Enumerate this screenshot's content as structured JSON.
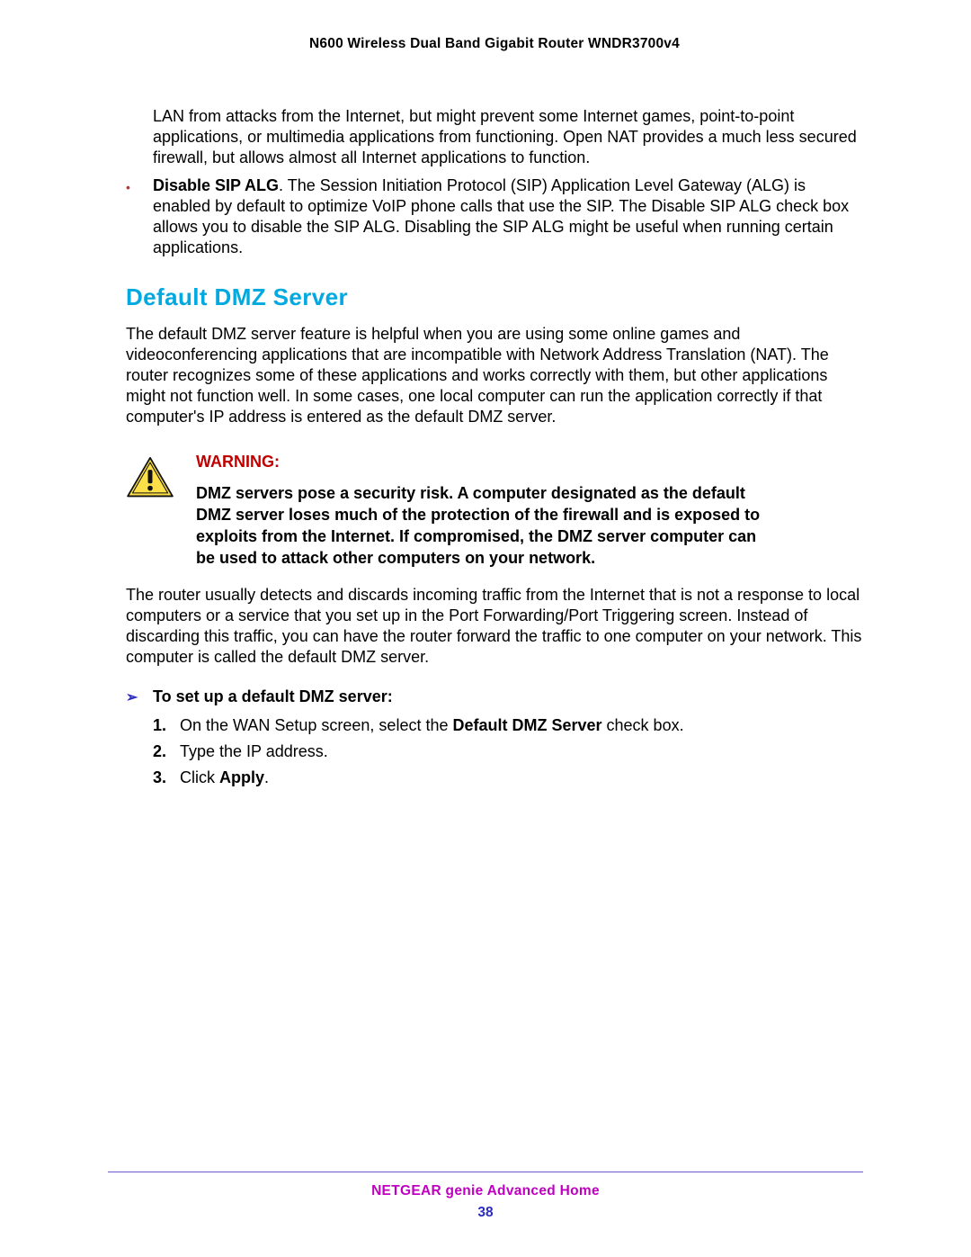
{
  "header": {
    "title": "N600 Wireless Dual Band Gigabit Router WNDR3700v4"
  },
  "continued": {
    "first_paragraph": "LAN from attacks from the Internet, but might prevent some Internet games, point-to-point applications, or multimedia applications from functioning. Open NAT provides a much less secured firewall, but allows almost all Internet applications to function.",
    "sip_label": "Disable SIP ALG",
    "sip_text": ". The Session Initiation Protocol (SIP) Application Level Gateway (ALG) is enabled by default to optimize VoIP phone calls that use the SIP. The Disable SIP ALG check box allows you to disable the SIP ALG. Disabling the SIP ALG might be useful when running certain applications."
  },
  "section": {
    "heading": "Default DMZ Server",
    "p1": "The default DMZ server feature is helpful when you are using some online games and videoconferencing applications that are incompatible with Network Address Translation (NAT). The router recognizes some of these applications and works correctly with them, but other applications might not function well. In some cases, one local computer can run the application correctly if that computer's IP address is entered as the default DMZ server.",
    "p2": "The router usually detects and discards incoming traffic from the Internet that is not a response to local computers or a service that you set up in the Port Forwarding/Port Triggering screen. Instead of discarding this traffic, you can have the router forward the traffic to one computer on your network. This computer is called the default DMZ server."
  },
  "warning": {
    "label": "WARNING:",
    "body": "DMZ servers pose a security risk. A computer designated as the default DMZ server loses much of the protection of the firewall and is exposed to exploits from the Internet. If compromised, the DMZ server computer can be used to attack other computers on your network."
  },
  "procedure": {
    "heading": "To set up a default DMZ server:",
    "steps": [
      {
        "n": "1.",
        "pre": "On the WAN Setup screen, select the ",
        "bold": "Default DMZ Server",
        "post": " check box."
      },
      {
        "n": "2.",
        "pre": "Type the IP address.",
        "bold": "",
        "post": ""
      },
      {
        "n": "3.",
        "pre": "Click ",
        "bold": "Apply",
        "post": "."
      }
    ]
  },
  "footer": {
    "line1": "NETGEAR genie Advanced Home",
    "page": "38"
  }
}
